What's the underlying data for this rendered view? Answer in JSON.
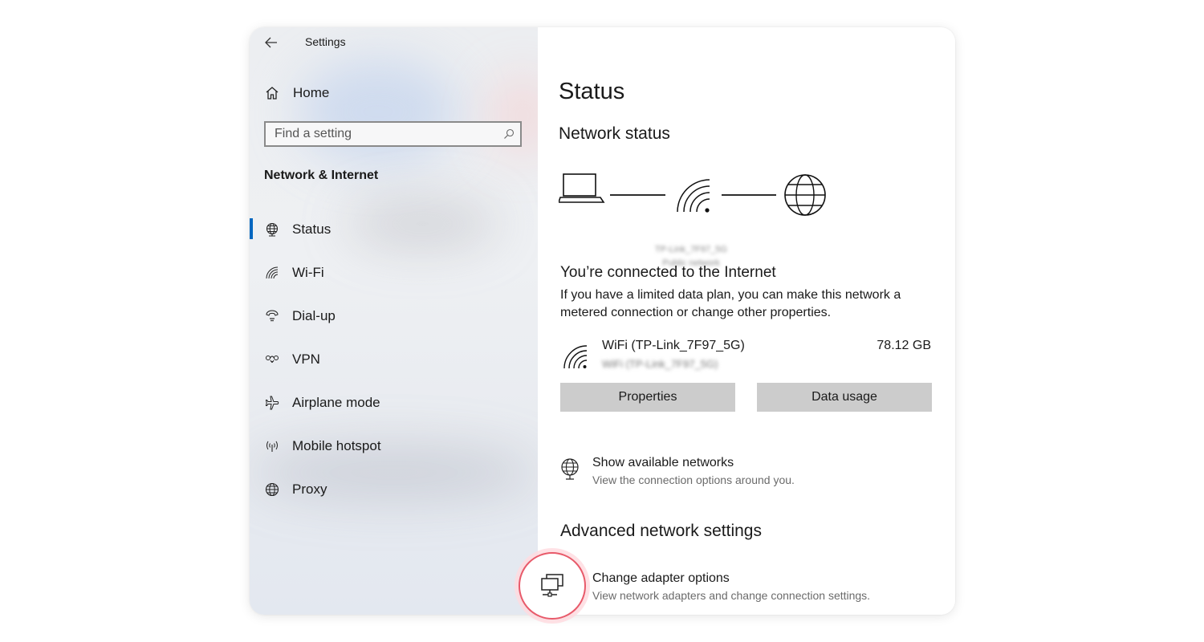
{
  "window": {
    "title": "Settings"
  },
  "sidebar": {
    "home_label": "Home",
    "search_placeholder": "Find a setting",
    "section_title": "Network & Internet",
    "items": [
      {
        "label": "Status",
        "icon": "globe-status-icon",
        "selected": true
      },
      {
        "label": "Wi-Fi",
        "icon": "wifi-icon",
        "selected": false
      },
      {
        "label": "Dial-up",
        "icon": "dialup-icon",
        "selected": false
      },
      {
        "label": "VPN",
        "icon": "vpn-icon",
        "selected": false
      },
      {
        "label": "Airplane mode",
        "icon": "airplane-icon",
        "selected": false
      },
      {
        "label": "Mobile hotspot",
        "icon": "hotspot-icon",
        "selected": false
      },
      {
        "label": "Proxy",
        "icon": "globe-icon",
        "selected": false
      }
    ]
  },
  "main": {
    "page_title": "Status",
    "network_status_title": "Network status",
    "diagram": {
      "network_name": "TP-Link_7F97_5G",
      "network_type": "Public network"
    },
    "connected_title": "You’re connected to the Internet",
    "connected_desc": "If you have a limited data plan, you can make this network a metered connection or change other properties.",
    "connection": {
      "name": "WiFi (TP-Link_7F97_5G)",
      "sub": "WiFi (TP-Link_7F97_5G)",
      "usage": "78.12 GB"
    },
    "buttons": {
      "properties": "Properties",
      "data_usage": "Data usage"
    },
    "show_networks": {
      "title": "Show available networks",
      "sub": "View the connection options around you."
    },
    "advanced_title": "Advanced network settings",
    "adapter": {
      "title": "Change adapter options",
      "sub": "View network adapters and change connection settings."
    }
  },
  "colors": {
    "accent": "#0067c0",
    "highlight_ring": "#e85a6a",
    "button_bg": "#cccccc"
  }
}
